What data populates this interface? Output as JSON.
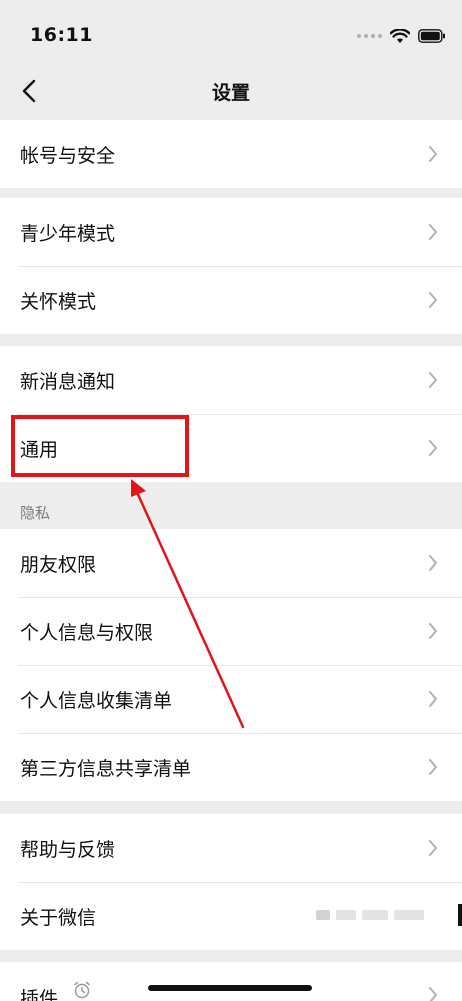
{
  "status_bar": {
    "time": "16:11"
  },
  "nav": {
    "title": "设置",
    "back_icon": "chevron-left-icon"
  },
  "groups": [
    {
      "items": [
        {
          "label": "帐号与安全"
        }
      ]
    },
    {
      "items": [
        {
          "label": "青少年模式"
        },
        {
          "label": "关怀模式"
        }
      ]
    },
    {
      "items": [
        {
          "label": "新消息通知"
        },
        {
          "label": "通用"
        }
      ]
    },
    {
      "section_title": "隐私",
      "items": [
        {
          "label": "朋友权限"
        },
        {
          "label": "个人信息与权限"
        },
        {
          "label": "个人信息收集清单"
        },
        {
          "label": "第三方信息共享清单"
        }
      ]
    },
    {
      "items": [
        {
          "label": "帮助与反馈"
        },
        {
          "label": "关于微信"
        }
      ]
    },
    {
      "items": [
        {
          "label": "插件"
        }
      ]
    }
  ],
  "annotation": {
    "highlight_color": "#e0151a",
    "arrow_color": "#e0151a"
  }
}
